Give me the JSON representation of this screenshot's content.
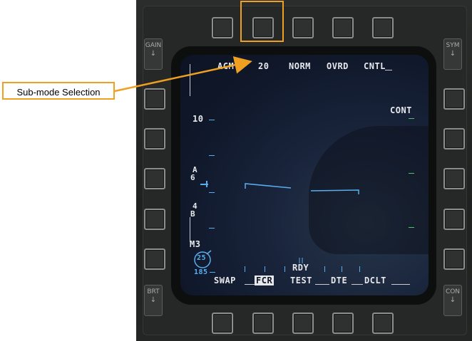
{
  "annotation": {
    "callout_label": "Sub-mode Selection",
    "color": "#f0a020"
  },
  "rockers": {
    "gain": "GAIN",
    "sym": "SYM",
    "brt": "BRT",
    "con": "CON",
    "up_arrow": "↑",
    "down_arrow": "↓"
  },
  "top_labels": {
    "acm": "ACM",
    "range": "20",
    "norm": "NORM",
    "ovrd": "OVRD",
    "cntl": "CNTL"
  },
  "right_labels": {
    "cont": "CONT"
  },
  "left_labels": {
    "range_scale": "10",
    "elev_a": "A",
    "elev_a_val": "6",
    "elev_b_num": "4",
    "elev_b": "B",
    "m3": "M3",
    "circle_val": "25",
    "alt_val": "185"
  },
  "bottom_labels": {
    "rdy": "RDY",
    "swap": "SWAP",
    "fcr": "FCR",
    "test": "TEST",
    "dte": "DTE",
    "dclt": "DCLT"
  },
  "colors": {
    "symbology_white": "#e6e8ec",
    "symbology_blue": "#5aaef0",
    "symbology_green": "#4fc46a",
    "display_bg": "#0f1729"
  }
}
